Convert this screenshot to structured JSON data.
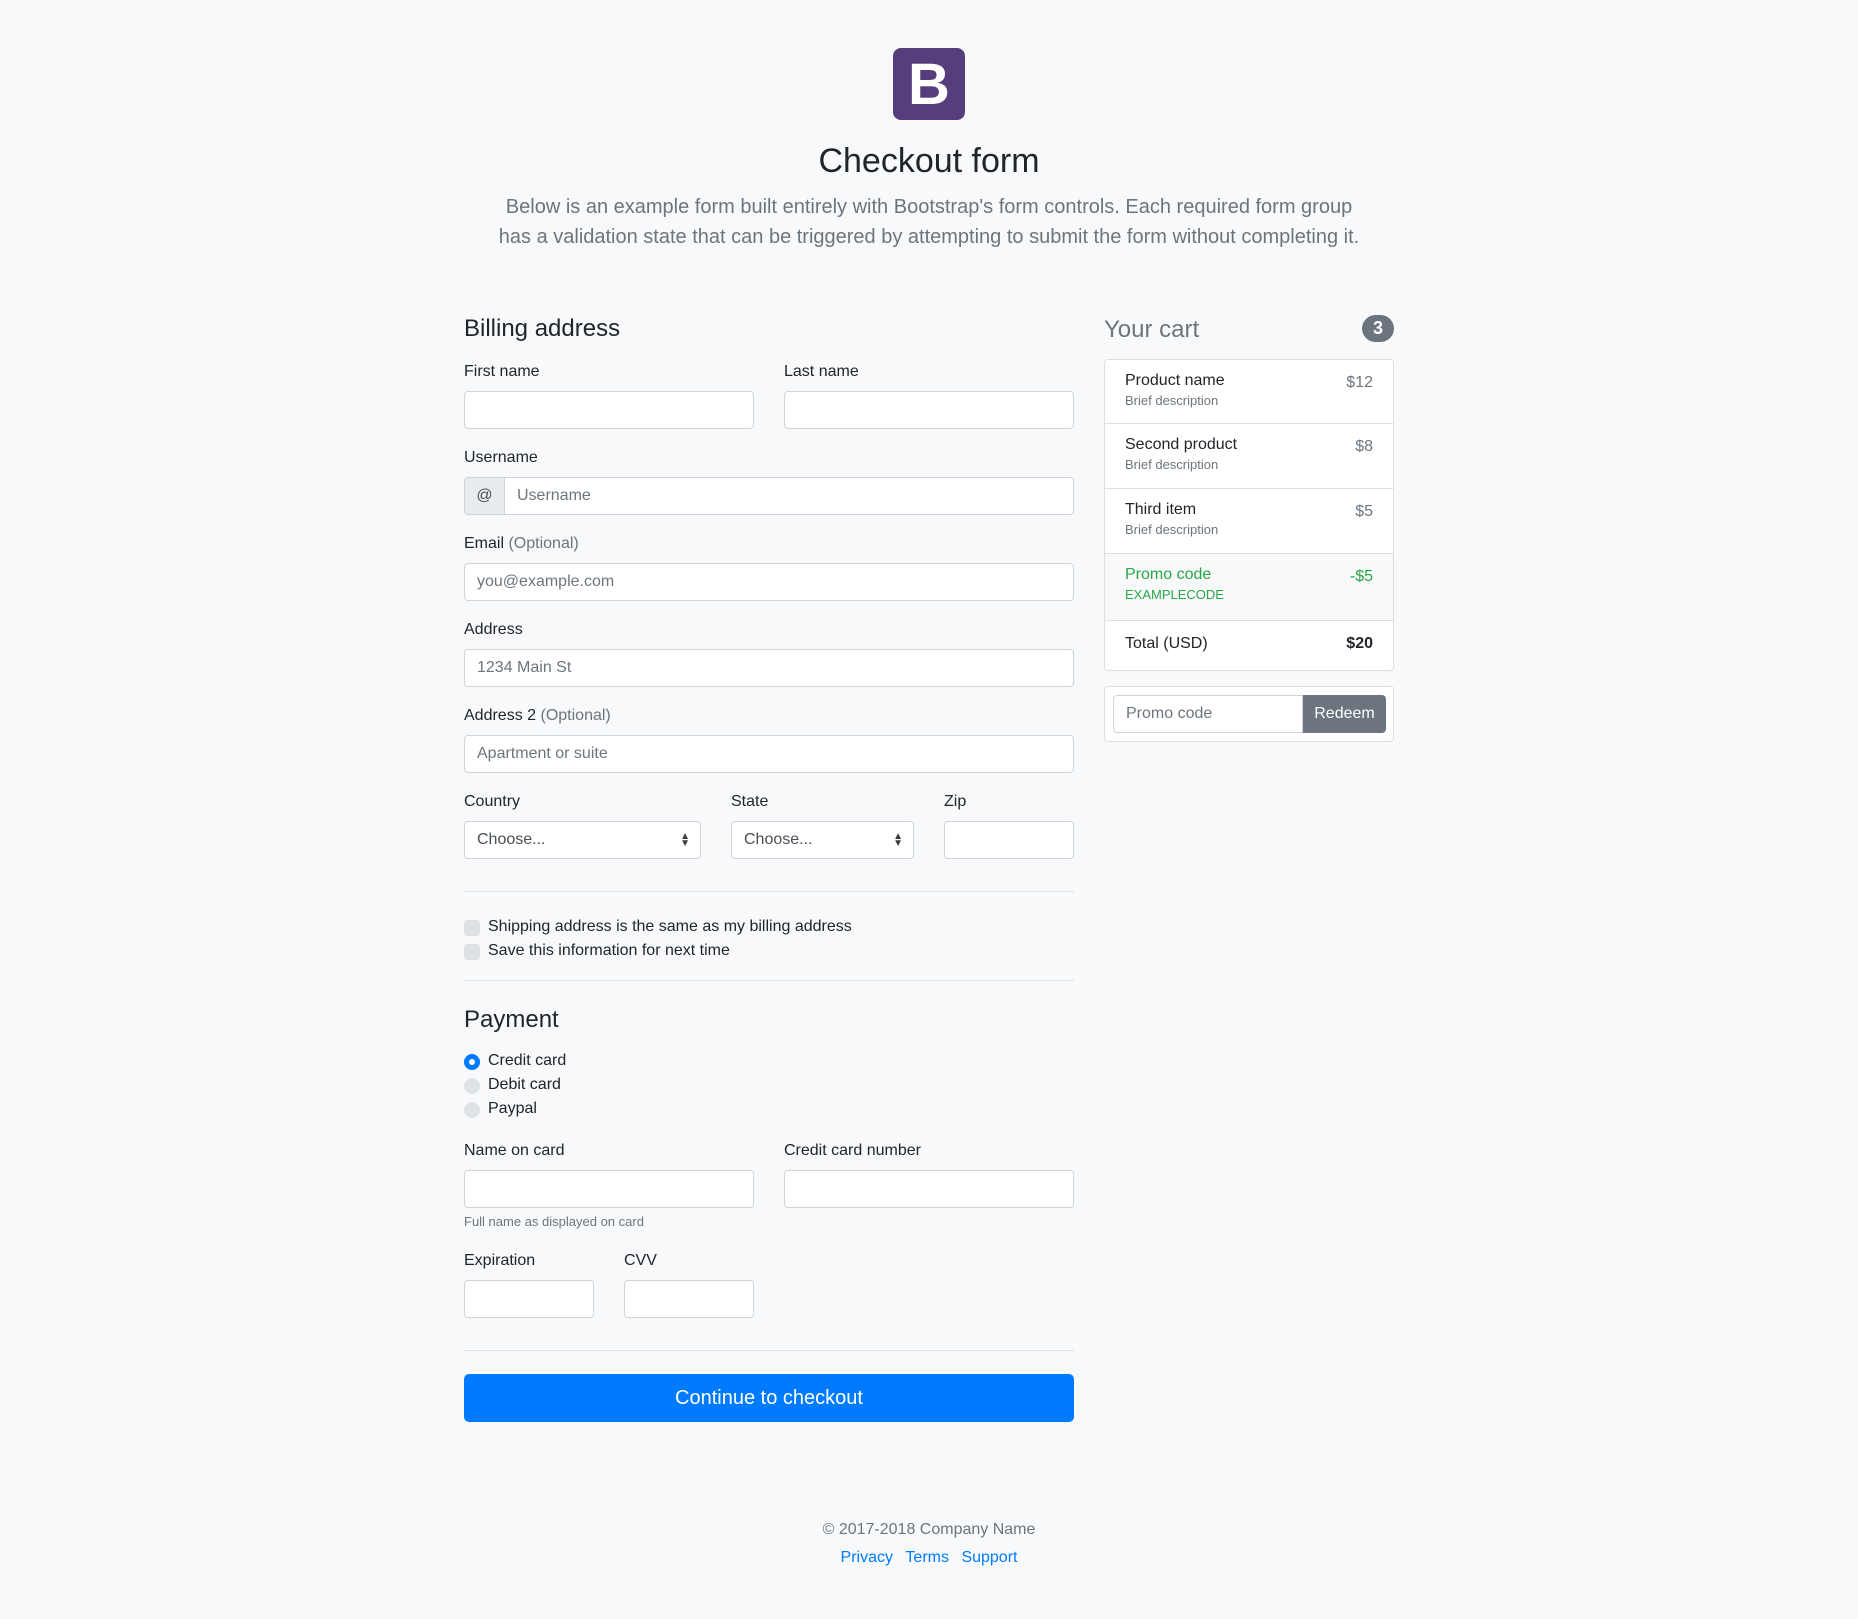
{
  "logo": {
    "letter": "B",
    "color": "#563d7c"
  },
  "header": {
    "title": "Checkout form",
    "lead": "Below is an example form built entirely with Bootstrap's form controls. Each required form group has a validation state that can be triggered by attempting to submit the form without completing it."
  },
  "billing": {
    "title": "Billing address",
    "first_name_label": "First name",
    "last_name_label": "Last name",
    "username_label": "Username",
    "username_prepend": "@",
    "username_placeholder": "Username",
    "email_label": "Email",
    "email_optional": "(Optional)",
    "email_placeholder": "you@example.com",
    "address_label": "Address",
    "address_placeholder": "1234 Main St",
    "address2_label": "Address 2",
    "address2_optional": "(Optional)",
    "address2_placeholder": "Apartment or suite",
    "country_label": "Country",
    "country_value": "Choose...",
    "state_label": "State",
    "state_value": "Choose...",
    "zip_label": "Zip"
  },
  "options": {
    "same_address": "Shipping address is the same as my billing address",
    "save_info": "Save this information for next time"
  },
  "payment": {
    "title": "Payment",
    "methods": [
      "Credit card",
      "Debit card",
      "Paypal"
    ],
    "selected": "Credit card",
    "name_on_card_label": "Name on card",
    "name_on_card_help": "Full name as displayed on card",
    "card_number_label": "Credit card number",
    "expiration_label": "Expiration",
    "cvv_label": "CVV"
  },
  "submit_label": "Continue to checkout",
  "cart": {
    "title": "Your cart",
    "count": "3",
    "items": [
      {
        "name": "Product name",
        "desc": "Brief description",
        "price": "$12"
      },
      {
        "name": "Second product",
        "desc": "Brief description",
        "price": "$8"
      },
      {
        "name": "Third item",
        "desc": "Brief description",
        "price": "$5"
      }
    ],
    "promo": {
      "name": "Promo code",
      "code": "EXAMPLECODE",
      "amount": "-$5"
    },
    "total": {
      "label": "Total (USD)",
      "amount": "$20"
    },
    "promo_placeholder": "Promo code",
    "redeem_label": "Redeem"
  },
  "footer": {
    "copyright": "© 2017-2018 Company Name",
    "links": [
      "Privacy",
      "Terms",
      "Support"
    ]
  },
  "colors": {
    "primary": "#007bff",
    "success": "#28a745",
    "secondary": "#6c757d"
  }
}
